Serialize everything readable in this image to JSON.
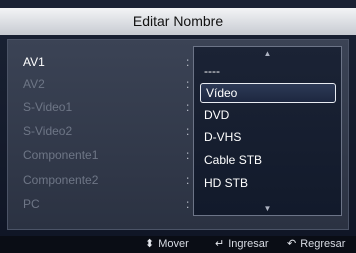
{
  "title": "Editar Nombre",
  "sources": [
    "AV1",
    "AV2",
    "S-Video1",
    "S-Video2",
    "Componente1",
    "Componente2",
    "PC"
  ],
  "dropdown": {
    "options": [
      "----",
      "Vídeo",
      "DVD",
      "D-VHS",
      "Cable STB",
      "HD STB"
    ],
    "selected": "Vídeo"
  },
  "footer": {
    "move": "Mover",
    "enter": "Ingresar",
    "return": "Regresar"
  }
}
